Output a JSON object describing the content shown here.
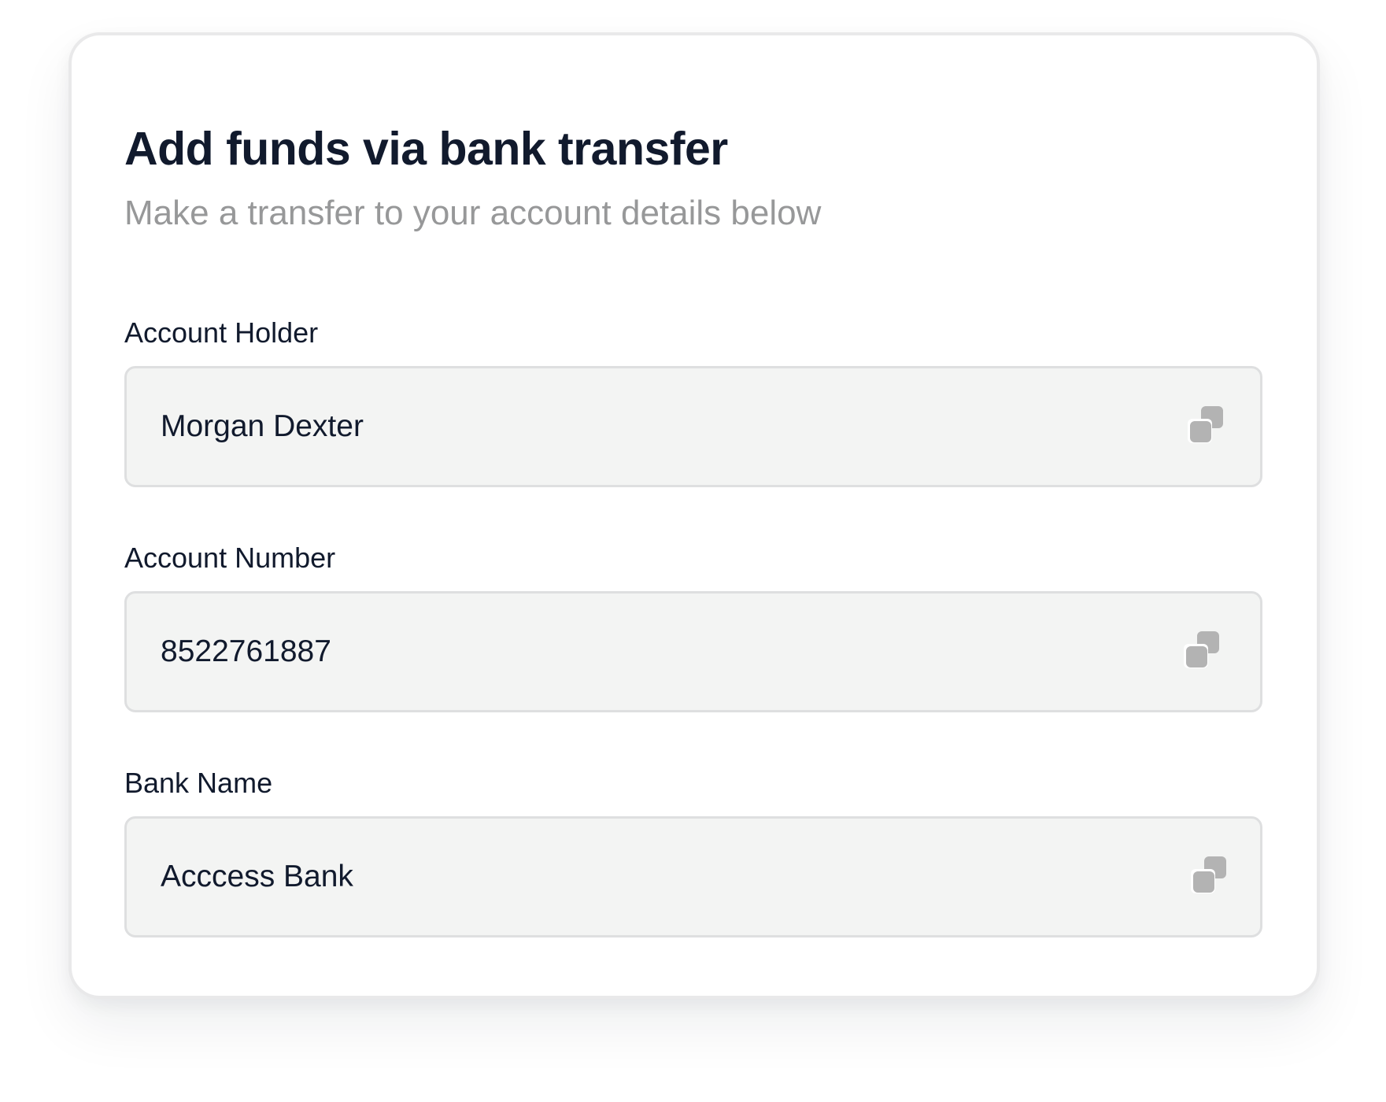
{
  "panel": {
    "title": "Add funds via bank transfer",
    "subtitle": "Make a transfer to your account details below"
  },
  "fields": [
    {
      "label": "Account Holder",
      "value": "Morgan Dexter",
      "action_icon": "copy-icon"
    },
    {
      "label": "Account Number",
      "value": "8522761887",
      "action_icon": "copy-icon"
    },
    {
      "label": "Bank Name",
      "value": "Acccess Bank",
      "action_icon": "copy-icon"
    }
  ],
  "colors": {
    "text_primary": "#111a2d",
    "text_muted": "#979899",
    "field_background": "#f3f4f3",
    "field_border": "#dedfe0",
    "icon": "#b3b3b3"
  }
}
